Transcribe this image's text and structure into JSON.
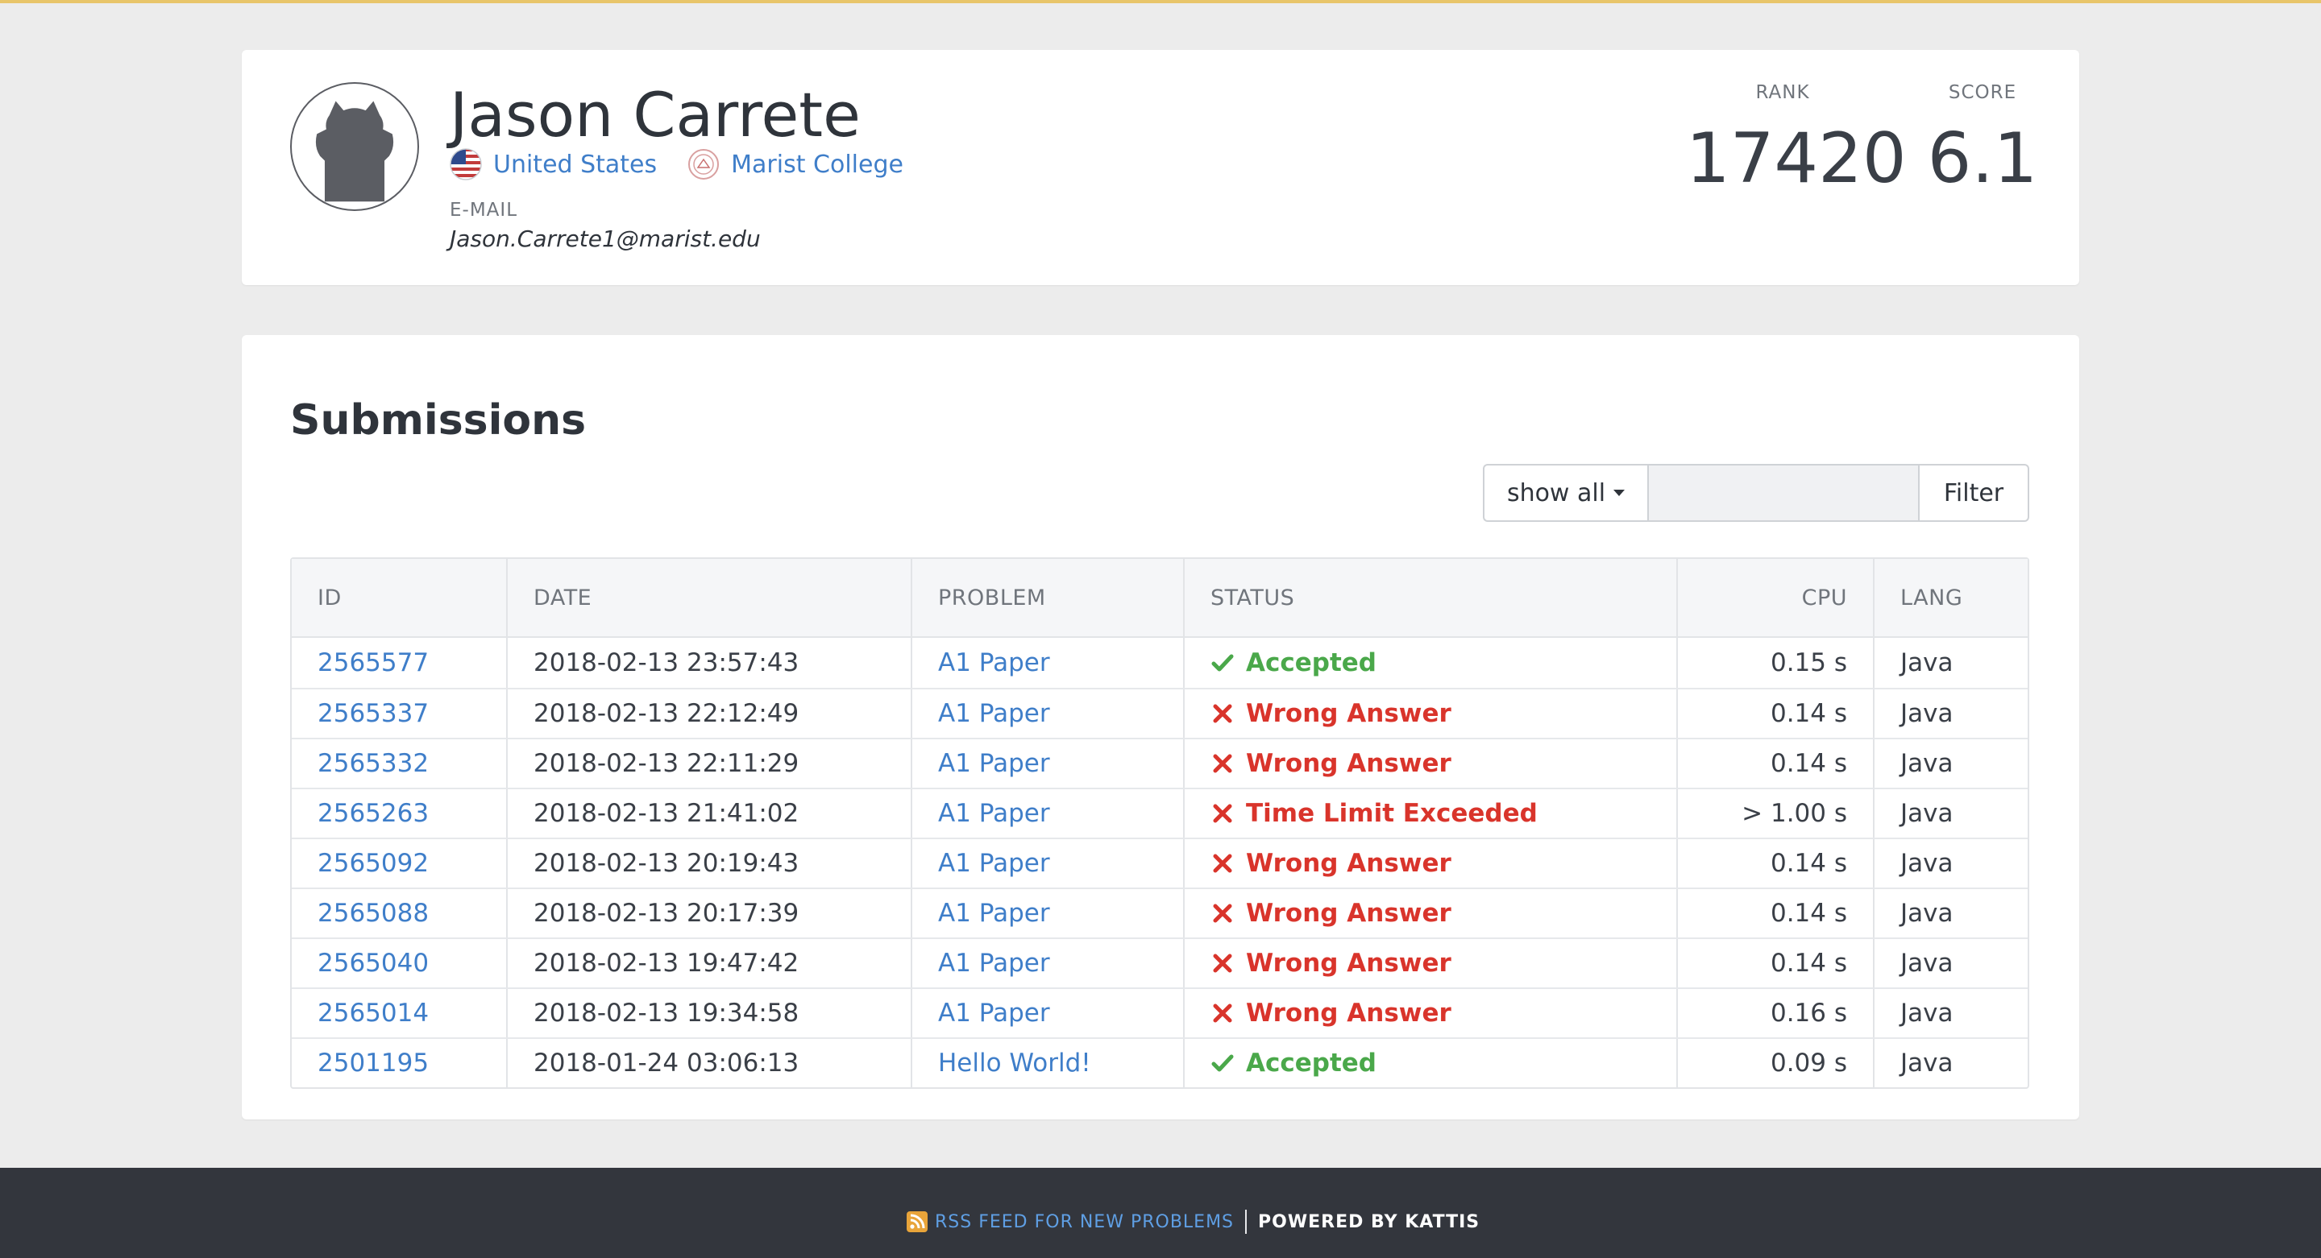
{
  "accent": {
    "top_line": "#e8c56a",
    "link": "#3f7ec9",
    "accepted": "#4aa84a",
    "wrong": "#d9342b"
  },
  "profile": {
    "name": "Jason Carrete",
    "country": "United States",
    "university": "Marist College",
    "email_label": "E-MAIL",
    "email": "Jason.Carrete1@marist.edu",
    "rank_label": "RANK",
    "rank": "17420",
    "score_label": "SCORE",
    "score": "6.1"
  },
  "submissions": {
    "title": "Submissions",
    "filter": {
      "select_label": "show all",
      "input_value": "",
      "button_label": "Filter"
    },
    "columns": {
      "id": "ID",
      "date": "DATE",
      "problem": "PROBLEM",
      "status": "STATUS",
      "cpu": "CPU",
      "lang": "LANG"
    },
    "rows": [
      {
        "id": "2565577",
        "date": "2018-02-13 23:57:43",
        "problem": "A1 Paper",
        "status": "Accepted",
        "status_icon": "check-icon",
        "cpu": "0.15 s",
        "lang": "Java"
      },
      {
        "id": "2565337",
        "date": "2018-02-13 22:12:49",
        "problem": "A1 Paper",
        "status": "Wrong Answer",
        "status_icon": "cross-icon",
        "cpu": "0.14 s",
        "lang": "Java"
      },
      {
        "id": "2565332",
        "date": "2018-02-13 22:11:29",
        "problem": "A1 Paper",
        "status": "Wrong Answer",
        "status_icon": "cross-icon",
        "cpu": "0.14 s",
        "lang": "Java"
      },
      {
        "id": "2565263",
        "date": "2018-02-13 21:41:02",
        "problem": "A1 Paper",
        "status": "Time Limit Exceeded",
        "status_icon": "cross-icon",
        "cpu": "> 1.00 s",
        "lang": "Java"
      },
      {
        "id": "2565092",
        "date": "2018-02-13 20:19:43",
        "problem": "A1 Paper",
        "status": "Wrong Answer",
        "status_icon": "cross-icon",
        "cpu": "0.14 s",
        "lang": "Java"
      },
      {
        "id": "2565088",
        "date": "2018-02-13 20:17:39",
        "problem": "A1 Paper",
        "status": "Wrong Answer",
        "status_icon": "cross-icon",
        "cpu": "0.14 s",
        "lang": "Java"
      },
      {
        "id": "2565040",
        "date": "2018-02-13 19:47:42",
        "problem": "A1 Paper",
        "status": "Wrong Answer",
        "status_icon": "cross-icon",
        "cpu": "0.14 s",
        "lang": "Java"
      },
      {
        "id": "2565014",
        "date": "2018-02-13 19:34:58",
        "problem": "A1 Paper",
        "status": "Wrong Answer",
        "status_icon": "cross-icon",
        "cpu": "0.16 s",
        "lang": "Java"
      },
      {
        "id": "2501195",
        "date": "2018-01-24 03:06:13",
        "problem": "Hello World!",
        "status": "Accepted",
        "status_icon": "check-icon",
        "cpu": "0.09 s",
        "lang": "Java"
      }
    ]
  },
  "footer": {
    "rss_label": "RSS FEED FOR NEW PROBLEMS",
    "powered_label": "POWERED BY KATTIS"
  }
}
